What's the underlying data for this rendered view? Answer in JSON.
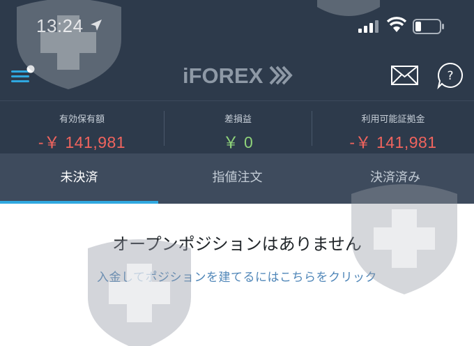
{
  "status_bar": {
    "time": "13:24"
  },
  "header": {
    "logo_text": "iFOREX",
    "icons": [
      "menu-icon",
      "mail-icon",
      "help-icon"
    ]
  },
  "summary": {
    "equity_label": "有効保有額",
    "equity_value": "-￥ 141,981",
    "pnl_label": "差損益",
    "pnl_value": "￥ 0",
    "margin_label": "利用可能証拠金",
    "margin_value": "-￥ 141,981"
  },
  "tabs": [
    {
      "label": "未決済",
      "active": true
    },
    {
      "label": "指値注文",
      "active": false
    },
    {
      "label": "決済済み",
      "active": false
    }
  ],
  "content": {
    "empty_message": "オープンポジションはありません",
    "deposit_link": "入金してポジションを建てるにはこちらをクリック"
  },
  "colors": {
    "header_bg": "#2d3a4b",
    "tabs_bg": "#3e4b5d",
    "negative": "#f0645e",
    "positive": "#8fd37a",
    "accent": "#2fa8e0",
    "link": "#4f86b8"
  }
}
